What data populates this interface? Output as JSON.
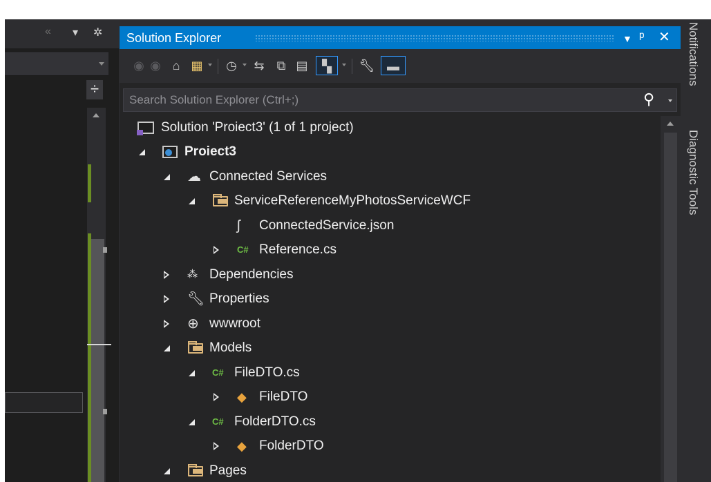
{
  "left_pane": {
    "header_icons": [
      "double-chevron-left-icon",
      "caret-down-icon",
      "gear-icon"
    ],
    "splitter_icon": "split-view-icon"
  },
  "solution_explorer": {
    "title": "Solution Explorer",
    "title_buttons": [
      "dropdown-icon",
      "pin-icon",
      "close-icon"
    ],
    "toolbar": [
      "back-icon",
      "forward-icon",
      "home-icon",
      "switch-views-icon",
      "pending-changes-filter-icon",
      "sync-with-active-document-icon",
      "collapse-all-icon",
      "show-all-files-icon",
      "preview-selected-items-icon",
      "properties-icon",
      "active-document-preview-icon"
    ],
    "search": {
      "placeholder": "Search Solution Explorer (Ctrl+;)",
      "value": ""
    },
    "tree": [
      {
        "label": "Solution 'Proiect3' (1 of 1 project)",
        "icon": "solution-icon",
        "level": 0,
        "expander": "none",
        "bold": false
      },
      {
        "label": "Proiect3",
        "icon": "web-project-icon",
        "level": 1,
        "expander": "open",
        "bold": true
      },
      {
        "label": "Connected Services",
        "icon": "connected-services-icon",
        "level": 2,
        "expander": "open",
        "bold": false
      },
      {
        "label": "ServiceReferenceMyPhotosServiceWCF",
        "icon": "folder-open-icon",
        "level": 3,
        "expander": "open",
        "bold": false
      },
      {
        "label": "ConnectedService.json",
        "icon": "json-file-icon",
        "level": 4,
        "expander": "none",
        "bold": false
      },
      {
        "label": "Reference.cs",
        "icon": "csharp-file-icon",
        "level": 4,
        "expander": "closed",
        "bold": false
      },
      {
        "label": "Dependencies",
        "icon": "dependencies-icon",
        "level": 2,
        "expander": "closed",
        "bold": false
      },
      {
        "label": "Properties",
        "icon": "wrench-icon",
        "level": 2,
        "expander": "closed",
        "bold": false
      },
      {
        "label": "wwwroot",
        "icon": "globe-icon",
        "level": 2,
        "expander": "closed",
        "bold": false
      },
      {
        "label": "Models",
        "icon": "folder-open-icon",
        "level": 2,
        "expander": "open",
        "bold": false
      },
      {
        "label": "FileDTO.cs",
        "icon": "csharp-file-icon",
        "level": 3,
        "expander": "open",
        "bold": false
      },
      {
        "label": "FileDTO",
        "icon": "class-icon",
        "level": 4,
        "expander": "closed",
        "bold": false
      },
      {
        "label": "FolderDTO.cs",
        "icon": "csharp-file-icon",
        "level": 3,
        "expander": "open",
        "bold": false
      },
      {
        "label": "FolderDTO",
        "icon": "class-icon",
        "level": 4,
        "expander": "closed",
        "bold": false
      },
      {
        "label": "Pages",
        "icon": "folder-open-icon",
        "level": 2,
        "expander": "open",
        "bold": false
      }
    ]
  },
  "right_tabs": [
    "Notifications",
    "Diagnostic Tools"
  ],
  "colors": {
    "title_bar": "#007acc",
    "panel_bg": "#252526",
    "chrome_bg": "#2d2d30",
    "folder": "#dcb67a",
    "csharp": "#6fbf45",
    "class": "#e8a33d"
  }
}
